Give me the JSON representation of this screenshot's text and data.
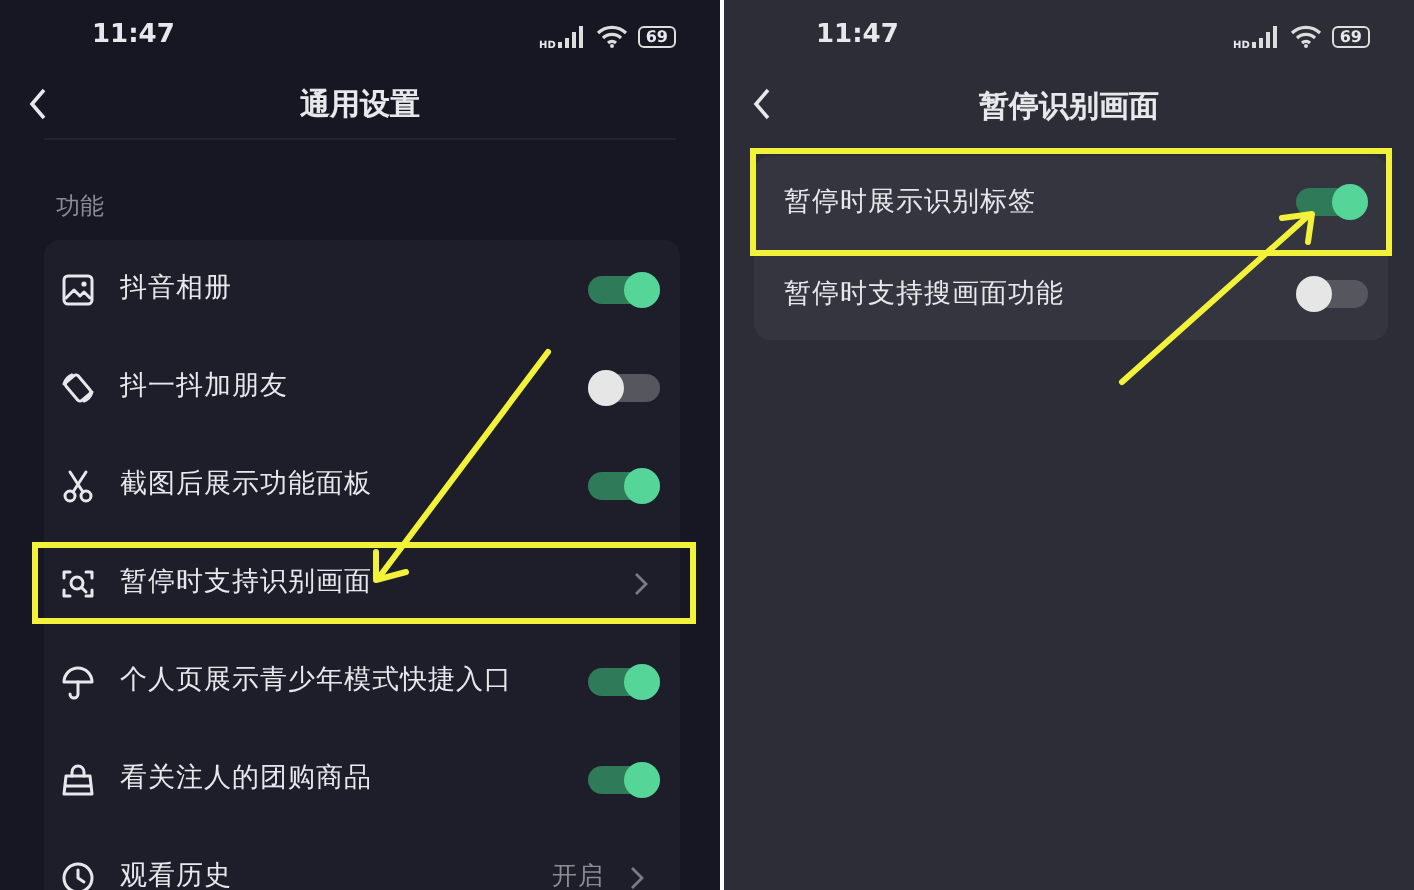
{
  "screens": [
    {
      "status_bar": {
        "time": "11:47",
        "network_label": "HD",
        "battery": "69"
      },
      "title": "通用设置",
      "section": "功能",
      "rows": [
        {
          "kind": "toggle",
          "label": "抖音相册",
          "on": true,
          "highlighted": false
        },
        {
          "kind": "toggle",
          "label": "抖一抖加朋友",
          "on": false,
          "highlighted": false
        },
        {
          "kind": "toggle",
          "label": "截图后展示功能面板",
          "on": true,
          "highlighted": false
        },
        {
          "kind": "link",
          "label": "暂停时支持识别画面",
          "highlighted": true
        },
        {
          "kind": "toggle",
          "label": "个人页展示青少年模式快捷入口",
          "on": true,
          "highlighted": false
        },
        {
          "kind": "toggle",
          "label": "看关注人的团购商品",
          "on": true,
          "highlighted": false
        },
        {
          "kind": "link",
          "label": "观看历史",
          "value": "开启",
          "highlighted": false
        }
      ]
    },
    {
      "status_bar": {
        "time": "11:47",
        "network_label": "HD",
        "battery": "69"
      },
      "title": "暂停识别画面",
      "rows": [
        {
          "kind": "toggle",
          "label": "暂停时展示识别标签",
          "on": true,
          "highlighted": true
        },
        {
          "kind": "toggle",
          "label": "暂停时支持搜画面功能",
          "on": false,
          "highlighted": false
        }
      ]
    }
  ]
}
